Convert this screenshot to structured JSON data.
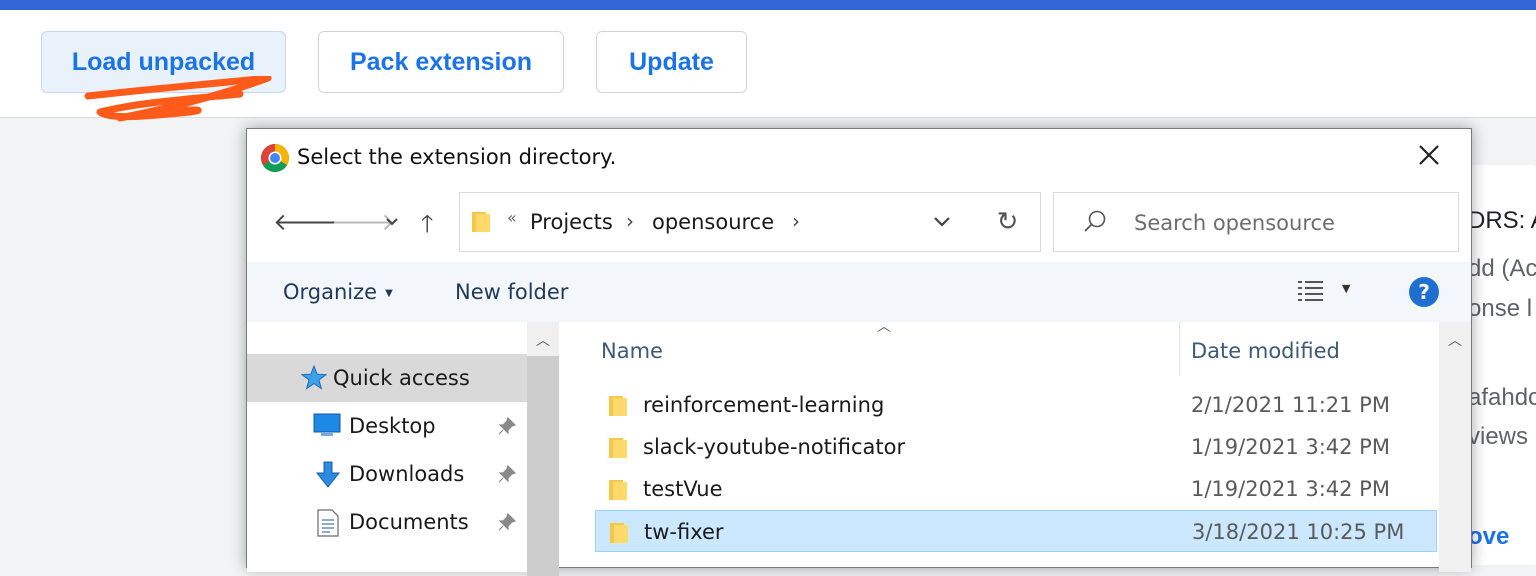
{
  "toolbar": {
    "load_unpacked": "Load unpacked",
    "pack_extension": "Pack extension",
    "update": "Update"
  },
  "background": {
    "line1": "DRS: A",
    "line2": "dd (Ac",
    "line3": "onse l",
    "line4": "afahdc",
    "line5": "views",
    "line6": "ove"
  },
  "dialog": {
    "title": "Select the extension directory.",
    "address": {
      "overflow": "«",
      "breadcrumbs": [
        "Projects",
        "opensource"
      ]
    },
    "search_placeholder": "Search opensource",
    "commands": {
      "organize": "Organize",
      "new_folder": "New folder",
      "help": "?"
    },
    "nav_items": [
      {
        "label": "Quick access",
        "icon": "star-icon",
        "selected": true
      },
      {
        "label": "Desktop",
        "icon": "desktop-icon",
        "pinned": true
      },
      {
        "label": "Downloads",
        "icon": "download-arrow-icon",
        "pinned": true
      },
      {
        "label": "Documents",
        "icon": "document-icon",
        "pinned": true
      }
    ],
    "columns": {
      "name": "Name",
      "date_modified": "Date modified"
    },
    "files": [
      {
        "name": "reinforcement-learning",
        "date": "2/1/2021 11:21 PM",
        "selected": false
      },
      {
        "name": "slack-youtube-notificator",
        "date": "1/19/2021 3:42 PM",
        "selected": false
      },
      {
        "name": "testVue",
        "date": "1/19/2021 3:42 PM",
        "selected": false
      },
      {
        "name": "tw-fixer",
        "date": "3/18/2021 10:25 PM",
        "selected": true
      }
    ]
  },
  "colors": {
    "chrome_blue": "#3367d6",
    "link_blue": "#1a73e8",
    "annotation_orange": "#ff5a1a",
    "selection_blue": "#cce8ff"
  }
}
